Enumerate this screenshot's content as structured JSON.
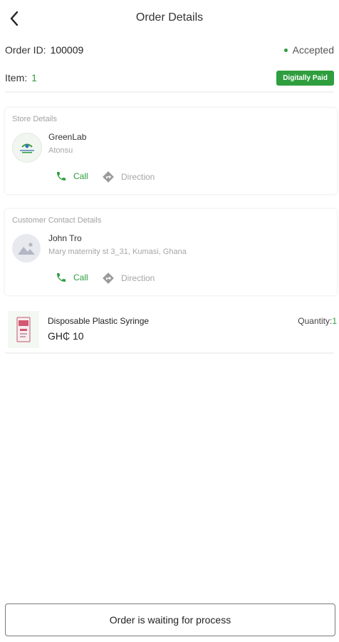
{
  "header": {
    "title": "Order Details"
  },
  "order": {
    "id_label": "Order ID:",
    "id_value": "100009",
    "status": "Accepted",
    "item_label": "Item:",
    "item_count": "1",
    "payment_badge": "Digitally Paid"
  },
  "store": {
    "section_title": "Store Details",
    "name": "GreenLab",
    "location": "Atonsu",
    "call_label": "Call",
    "direction_label": "Direction"
  },
  "customer": {
    "section_title": "Customer Contact Details",
    "name": "John Tro",
    "address": "Mary maternity st 3_31, Kumasi, Ghana",
    "call_label": "Call",
    "direction_label": "Direction"
  },
  "product": {
    "name": "Disposable Plastic Syringe",
    "price": "GH₵ 10",
    "quantity_label": "Quantity:",
    "quantity_value": "1"
  },
  "footer": {
    "status_button": "Order is waiting for process"
  },
  "colors": {
    "accent": "#2e9e3e",
    "muted": "#a6a6a6"
  }
}
